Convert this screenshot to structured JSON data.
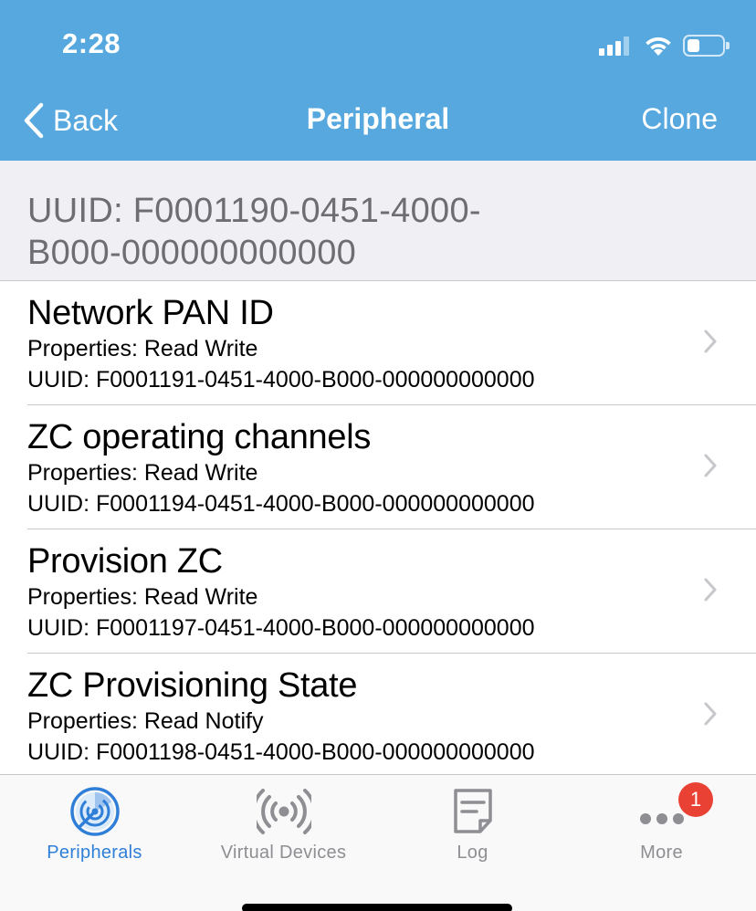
{
  "status_bar": {
    "time": "2:28"
  },
  "nav": {
    "back_label": "Back",
    "title": "Peripheral",
    "action_label": "Clone"
  },
  "section_header": {
    "line1": "UUID: F0001190-0451-4000-",
    "line2": "B000-000000000000"
  },
  "characteristics": [
    {
      "title": "Network PAN ID",
      "properties": "Properties: Read Write",
      "uuid": "UUID: F0001191-0451-4000-B000-000000000000"
    },
    {
      "title": "ZC operating channels",
      "properties": "Properties: Read Write",
      "uuid": "UUID: F0001194-0451-4000-B000-000000000000"
    },
    {
      "title": "Provision ZC",
      "properties": "Properties: Read Write",
      "uuid": "UUID: F0001197-0451-4000-B000-000000000000"
    },
    {
      "title": "ZC Provisioning State",
      "properties": "Properties: Read Notify",
      "uuid": "UUID: F0001198-0451-4000-B000-000000000000"
    }
  ],
  "tabs": [
    {
      "label": "Peripherals",
      "icon": "radar-icon",
      "active": true
    },
    {
      "label": "Virtual Devices",
      "icon": "broadcast-icon",
      "active": false
    },
    {
      "label": "Log",
      "icon": "log-note-icon",
      "active": false
    },
    {
      "label": "More",
      "icon": "more-dots-icon",
      "active": false,
      "badge": "1"
    }
  ],
  "colors": {
    "nav_bar": "#56A8DF",
    "tab_active": "#2F7FD8",
    "tab_inactive": "#8e8e93",
    "badge": "#E94235",
    "section_bg": "#EFEFF4"
  }
}
